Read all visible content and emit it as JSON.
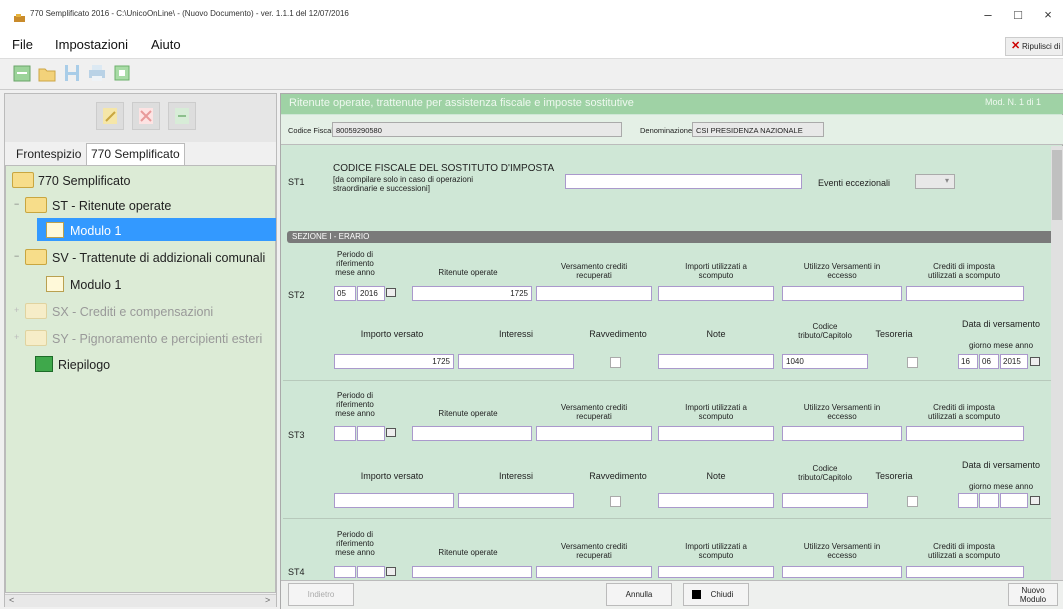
{
  "window": {
    "title": "770 Semplificato 2016 - C:\\UnicoOnLine\\ - (Nuovo Documento) - ver. 1.1.1 del 12/07/2016",
    "minimize": "–",
    "maximize": "□",
    "close": "×"
  },
  "menu": {
    "file": "File",
    "settings": "Impostazioni",
    "help": "Aiuto",
    "clear": "Ripulisci di"
  },
  "tabs": {
    "front": "Frontespizio",
    "s770": "770 Semplificato"
  },
  "tree": {
    "root": "770 Semplificato",
    "st": "ST - Ritenute operate",
    "st_mod": "Modulo 1",
    "sv": "SV - Trattenute di addizionali comunali",
    "sv_mod": "Modulo 1",
    "sx": "SX - Crediti e compensazioni",
    "sy": "SY - Pignoramento e percipienti esteri",
    "riepilogo": "Riepilogo",
    "expand": "+",
    "collapse": "−"
  },
  "panel": {
    "title": "Ritenute operate, trattenute per assistenza fiscale e imposte sostitutive",
    "pager": "Mod. N. 1 di 1",
    "cf_label": "Codice Fiscale:",
    "cf_value": "80059290580",
    "den_label": "Denominazione:",
    "den_value": "CSI PRESIDENZA NAZIONALE"
  },
  "st1": {
    "code": "ST1",
    "title": "CODICE FISCALE DEL SOSTITUTO D'IMPOSTA",
    "note1": "[da compilare solo in caso di operazioni",
    "note2": "straordinarie e successioni]",
    "eventi": "Eventi eccezionali"
  },
  "section": {
    "title": "SEZIONE I - ERARIO"
  },
  "labels": {
    "periodo1": "Periodo di",
    "periodo2": "riferimento",
    "periodo3": "mese anno",
    "ritenute": "Ritenute operate",
    "vers1": "Versamento crediti",
    "vers2": "recuperati",
    "imp1": "Importi utilizzati a",
    "imp2": "scomputo",
    "util1": "Utilizzo Versamenti in",
    "util2": "eccesso",
    "cred1": "Crediti di imposta",
    "cred2": "utilizzati a scomputo",
    "importo": "Importo versato",
    "interessi": "Interessi",
    "ravv": "Ravvedimento",
    "note": "Note",
    "cod1": "Codice",
    "cod2": "tributo/Capitolo",
    "tesoreria": "Tesoreria",
    "data": "Data di versamento",
    "gma": "giorno mese anno"
  },
  "st2": {
    "code": "ST2",
    "mese": "05",
    "anno": "2016",
    "ritenute": "1725",
    "importo": "1725",
    "codice": "1040",
    "giorno": "16",
    "mese_v": "06",
    "anno_v": "2015"
  },
  "st3": {
    "code": "ST3"
  },
  "st4": {
    "code": "ST4"
  },
  "buttons": {
    "back": "Indietro",
    "cancel": "Annulla",
    "close": "Chiudi",
    "new1": "Nuovo",
    "new2": "Modulo"
  },
  "scroll": {
    "left": "<",
    "right": ">"
  }
}
